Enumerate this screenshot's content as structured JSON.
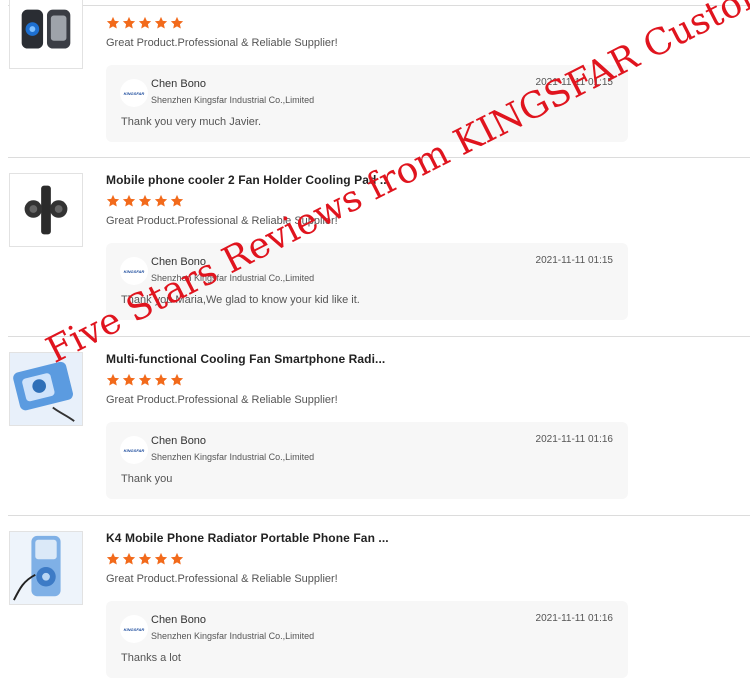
{
  "reviews": [
    {
      "title": "",
      "stars": 5,
      "comment": "Great Product.Professional & Reliable Supplier!",
      "reply": {
        "name": "Chen Bono",
        "company": "Shenzhen Kingsfar Industrial Co.,Limited",
        "date": "2021-11-11 01:15",
        "text": "Thank you very much Javier."
      }
    },
    {
      "title": "Mobile phone cooler 2 Fan Holder Cooling Pad ...",
      "stars": 5,
      "comment": "Great Product.Professional & Reliable Supplier!",
      "reply": {
        "name": "Chen Bono",
        "company": "Shenzhen Kingsfar Industrial Co.,Limited",
        "date": "2021-11-11 01:15",
        "text": "Thank you Maria,We glad to know your kid like it."
      }
    },
    {
      "title": "Multi-functional Cooling Fan Smartphone Radi...",
      "stars": 5,
      "comment": "Great Product.Professional & Reliable Supplier!",
      "reply": {
        "name": "Chen Bono",
        "company": "Shenzhen Kingsfar Industrial Co.,Limited",
        "date": "2021-11-11 01:16",
        "text": "Thank you"
      }
    },
    {
      "title": "K4 Mobile Phone Radiator Portable Phone Fan ...",
      "stars": 5,
      "comment": "Great Product.Professional & Reliable Supplier!",
      "reply": {
        "name": "Chen Bono",
        "company": "Shenzhen Kingsfar Industrial Co.,Limited",
        "date": "2021-11-11 01:16",
        "text": "Thanks a lot"
      }
    }
  ],
  "watermark": "Five Stars Reviews from KINGSFAR Customers",
  "brand_logo_text": "KINGSFAR",
  "colors": {
    "star": "#f26a1b",
    "watermark": "#e0141e",
    "reply_bg": "#f7f7f7",
    "separator": "#dcdcdc"
  },
  "icons": {
    "star": "star-icon",
    "avatar": "kingsfar-logo-icon"
  }
}
